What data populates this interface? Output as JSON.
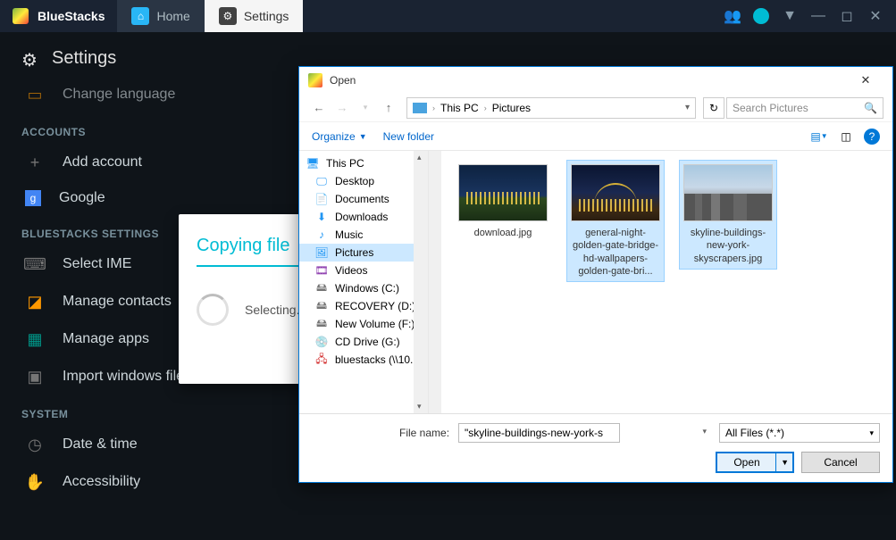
{
  "topbar": {
    "app_name": "BlueStacks",
    "tabs": {
      "home": "Home",
      "settings": "Settings"
    }
  },
  "settings_page": {
    "title": "Settings",
    "item_change_language": "Change language",
    "section_accounts": "ACCOUNTS",
    "item_add_account": "Add account",
    "item_google": "Google",
    "section_bluestacks": "BLUESTACKS SETTINGS",
    "item_select_ime": "Select IME",
    "item_manage_contacts": "Manage contacts",
    "item_manage_apps": "Manage apps",
    "item_import_files": "Import windows files",
    "section_system": "SYSTEM",
    "item_date_time": "Date & time",
    "item_accessibility": "Accessibility"
  },
  "copy_popup": {
    "title": "Copying file",
    "status": "Selecting..."
  },
  "dialog": {
    "title": "Open",
    "breadcrumb": {
      "root": "This PC",
      "folder": "Pictures"
    },
    "search_placeholder": "Search Pictures",
    "toolbar": {
      "organize": "Organize",
      "new_folder": "New folder"
    },
    "tree": {
      "this_pc": "This PC",
      "desktop": "Desktop",
      "documents": "Documents",
      "downloads": "Downloads",
      "music": "Music",
      "pictures": "Pictures",
      "videos": "Videos",
      "windows_c": "Windows (C:)",
      "recovery_d": "RECOVERY (D:)",
      "new_volume_f": "New Volume (F:)",
      "cd_drive_g": "CD Drive (G:)",
      "bluestacks_net": "bluestacks (\\\\10..."
    },
    "files": [
      {
        "name": "download.jpg"
      },
      {
        "name": "general-night-golden-gate-bridge-hd-wallpapers-golden-gate-bri..."
      },
      {
        "name": "skyline-buildings-new-york-skyscrapers.jpg"
      }
    ],
    "footer": {
      "file_name_label": "File name:",
      "file_name_value": "\"skyline-buildings-new-york-skyscrapers.jpg\"",
      "filter": "All Files (*.*)",
      "open": "Open",
      "cancel": "Cancel"
    }
  }
}
